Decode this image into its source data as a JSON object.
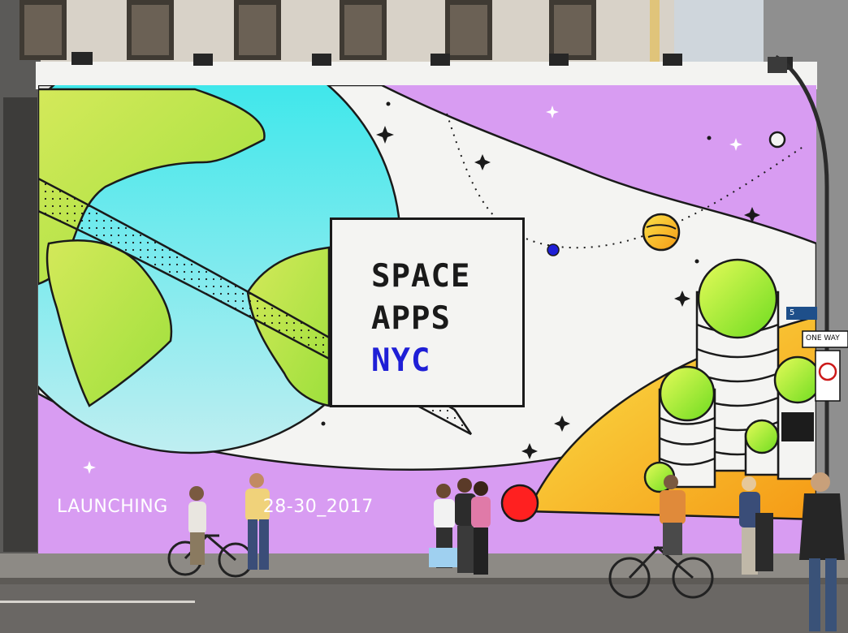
{
  "poster": {
    "title_line1": "SPACE",
    "title_line2": "APPS",
    "title_line3": "NYC",
    "launch_label": "LAUNCHING",
    "launch_date": "28-30_2017",
    "accent_color": "#1f1fd6",
    "mural_colors": {
      "lavender": "#d89cf2",
      "cyan": "#22e4ea",
      "lime": "#a8e63a",
      "orange": "#f7a21b"
    }
  },
  "street_signs": {
    "fifth_ave": "5",
    "one_way": "ONE WAY"
  }
}
